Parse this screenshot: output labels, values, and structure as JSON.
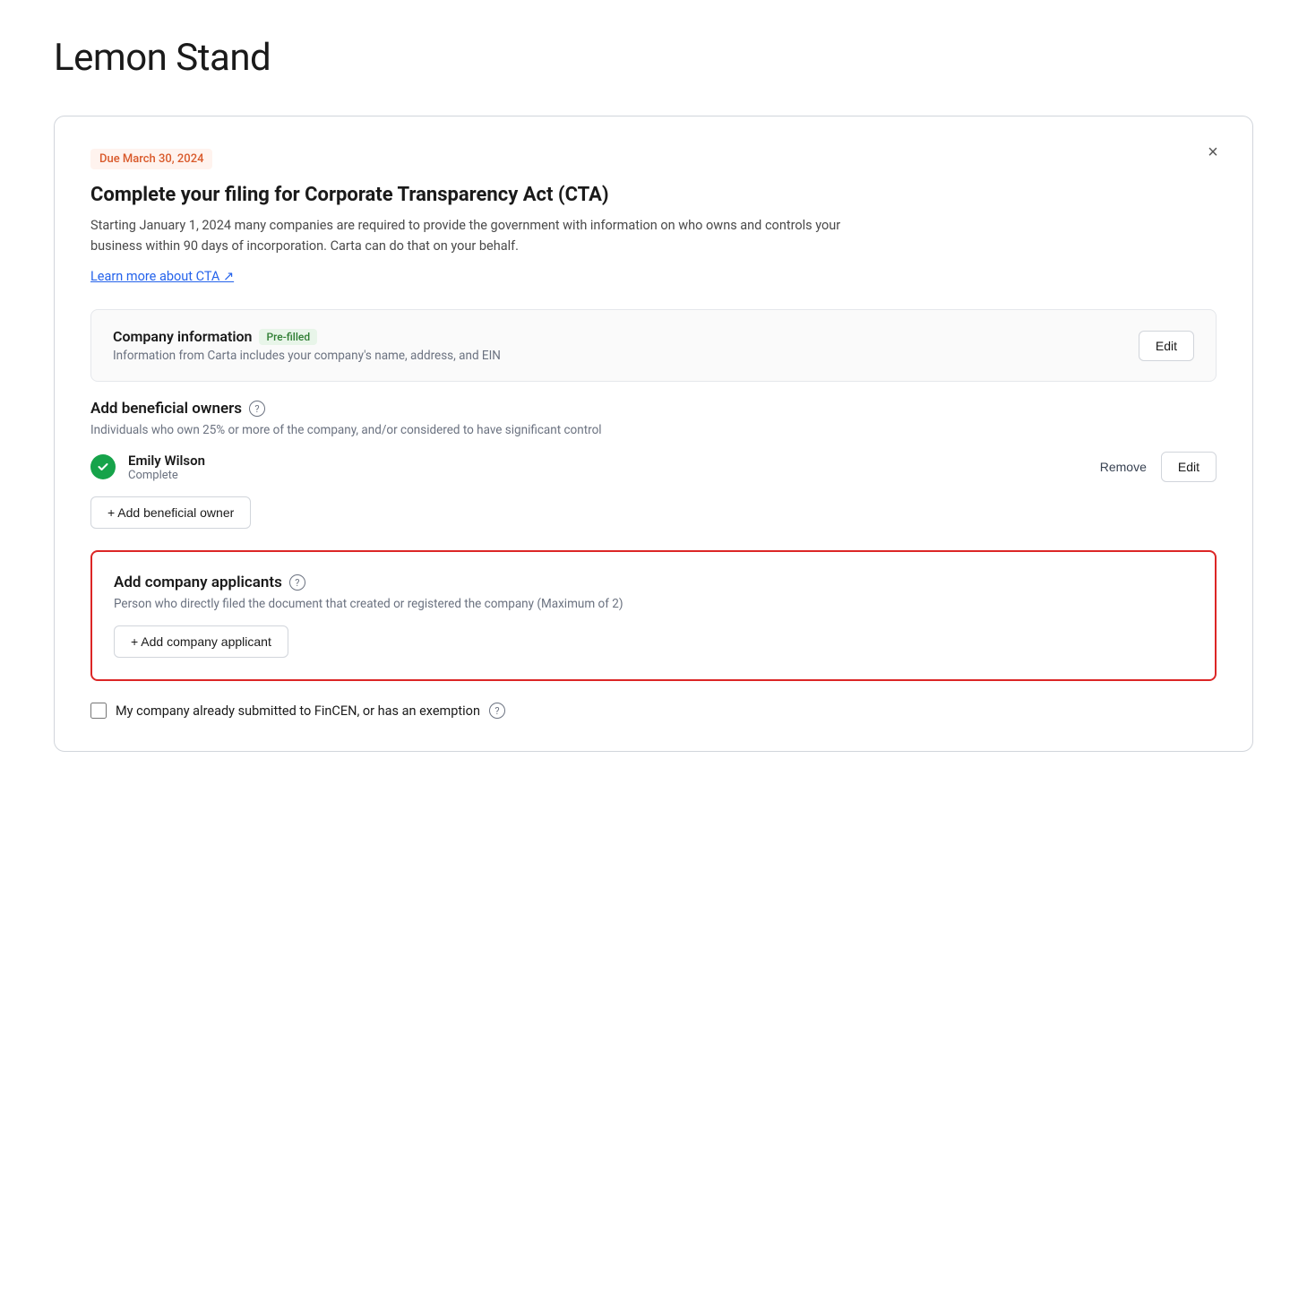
{
  "page": {
    "title": "Lemon Stand"
  },
  "card": {
    "due_badge": "Due March 30, 2024",
    "main_title": "Complete your filing for Corporate Transparency Act (CTA)",
    "description": "Starting January 1, 2024 many companies are required to provide the government with information on who owns and controls your business within 90 days of incorporation. Carta can do that on your behalf.",
    "learn_more_link": "Learn more about CTA ↗",
    "close_label": "×"
  },
  "company_info": {
    "title": "Company information",
    "badge": "Pre-filled",
    "description": "Information from Carta includes your company's name, address, and EIN",
    "edit_label": "Edit"
  },
  "beneficial_owners": {
    "title": "Add beneficial owners",
    "subtitle": "Individuals who own 25% or more of the company, and/or considered to have significant control",
    "owner": {
      "name": "Emily Wilson",
      "status": "Complete",
      "remove_label": "Remove",
      "edit_label": "Edit"
    },
    "add_button": "+ Add beneficial owner"
  },
  "company_applicants": {
    "title": "Add company applicants",
    "subtitle": "Person who directly filed the document that created or registered the company (Maximum of 2)",
    "add_button": "+ Add company applicant"
  },
  "fincen": {
    "label": "My company already submitted to FinCEN, or has an exemption"
  },
  "icons": {
    "close": "×",
    "check": "✓",
    "question": "?",
    "plus": "+"
  }
}
